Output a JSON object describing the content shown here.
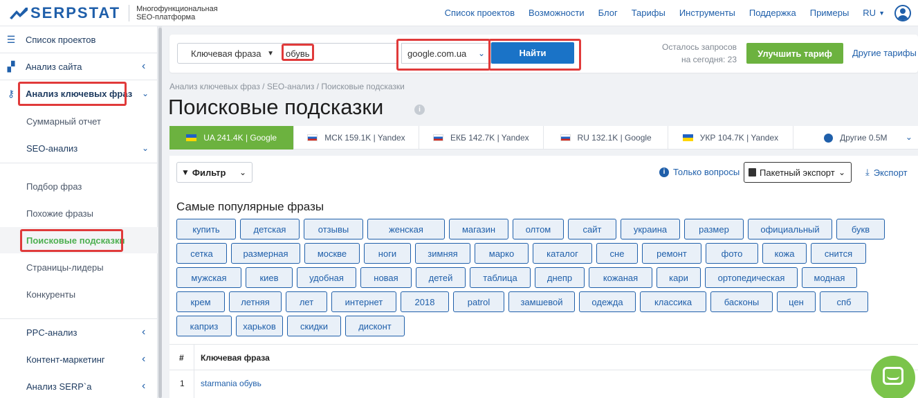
{
  "header": {
    "logo_text": "SERPSTAT",
    "logo_subtitle_line1": "Многофункциональная",
    "logo_subtitle_line2": "SEO-платформа",
    "nav": [
      "Список проектов",
      "Возможности",
      "Блог",
      "Тарифы",
      "Инструменты",
      "Поддержка",
      "Примеры"
    ],
    "lang": "RU"
  },
  "sidebar": {
    "projects": "Список проектов",
    "site_analysis": "Анализ сайта",
    "keyword_analysis": "Анализ ключевых фраз",
    "summary_report": "Суммарный отчет",
    "seo_analysis": "SEO-анализ",
    "sub": [
      "Подбор фраз",
      "Похожие фразы",
      "Поисковые подсказки",
      "Страницы-лидеры",
      "Конкуренты"
    ],
    "ppc": "PPC-анализ",
    "content_marketing": "Контент-маркетинг",
    "serp_analysis": "Анализ SERP`а"
  },
  "search": {
    "type_label": "Ключевая фраза",
    "keyword_value": "обувь",
    "database": "google.com.ua",
    "find_label": "Найти",
    "remaining_line1": "Осталось запросов",
    "remaining_line2": "на сегодня: 23",
    "upgrade_label": "Улучшить тариф",
    "other_plans": "Другие тарифы"
  },
  "breadcrumb": "Анализ ключевых фраз / SEO-анализ / Поисковые подсказки",
  "page_title": "Поисковые подсказки",
  "info_icon": "i",
  "tabs": [
    {
      "flag": "ua",
      "label": "UA 241.4K | Google"
    },
    {
      "flag": "ru",
      "label": "МСК 159.1K | Yandex"
    },
    {
      "flag": "ru",
      "label": "ЕКБ 142.7K | Yandex"
    },
    {
      "flag": "ru",
      "label": "RU 132.1K | Google"
    },
    {
      "flag": "ua",
      "label": "УКР 104.7K | Yandex"
    },
    {
      "flag": "globe",
      "label": "Другие 0.5M"
    }
  ],
  "toolbar": {
    "filter_label": "Фильтр",
    "only_questions": "Только вопросы",
    "batch_export": "Пакетный экспорт",
    "export": "Экспорт"
  },
  "popular_title": "Самые популярные фразы",
  "chip_rows": [
    [
      "купить",
      "детская",
      "отзывы",
      "женская",
      "магазин",
      "олтом",
      "сайт",
      "украина",
      "размер",
      "официальный",
      "букв"
    ],
    [
      "сетка",
      "размерная",
      "москве",
      "ноги",
      "зимняя",
      "марко",
      "каталог",
      "сне",
      "ремонт",
      "фото",
      "кожа",
      "снится"
    ],
    [
      "мужская",
      "киев",
      "удобная",
      "новая",
      "детей",
      "таблица",
      "днепр",
      "кожаная",
      "кари",
      "ортопедическая",
      "модная"
    ],
    [
      "крем",
      "летняя",
      "лет",
      "интернет",
      "2018",
      "patrol",
      "замшевой",
      "одежда",
      "классика",
      "басконы",
      "цен",
      "спб"
    ],
    [
      "каприз",
      "харьков",
      "скидки",
      "дисконт"
    ]
  ],
  "table": {
    "col_num": "#",
    "col_keyword": "Ключевая фраза",
    "rows": [
      {
        "num": "1",
        "keyword": "starmania обувь"
      }
    ]
  },
  "colors": {
    "brand_blue": "#1f5faa",
    "accent_green": "#6cb23f",
    "highlight_red": "#e03a3a"
  }
}
